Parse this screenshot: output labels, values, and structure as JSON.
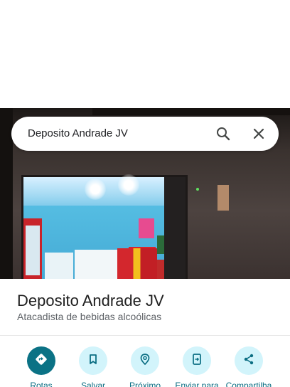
{
  "search": {
    "query": "Deposito Andrade JV"
  },
  "place": {
    "name": "Deposito Andrade JV",
    "category": "Atacadista de bebidas alcoólicas"
  },
  "actions": [
    {
      "label": "Rotas",
      "icon": "directions-icon"
    },
    {
      "label": "Salvar",
      "icon": "bookmark-icon"
    },
    {
      "label": "Próximo",
      "icon": "nearby-icon"
    },
    {
      "label": "Enviar para",
      "icon": "send-to-phone-icon"
    },
    {
      "label": "Compartilha",
      "icon": "share-icon"
    }
  ],
  "colors": {
    "accent": "#0b7285",
    "action_bg": "#d2f4fb",
    "label": "#0b6e83"
  }
}
